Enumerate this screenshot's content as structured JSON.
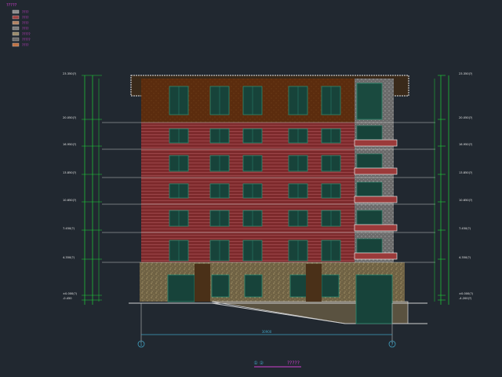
{
  "colors": {
    "background": "#212830",
    "brick": "#8a2f31",
    "roof_wood": "#5a2e10",
    "stone": "#8a7a52",
    "glass": "#17433a",
    "dim_green": "#1fd23a",
    "magenta": "#cf3fcf",
    "cyan": "#40a0c0",
    "white": "#e8e8e8"
  },
  "legend": {
    "title": "?????",
    "items": [
      {
        "label": "????",
        "swatch": "#8a8a8a"
      },
      {
        "label": "????",
        "swatch": "#a04040"
      },
      {
        "label": "????",
        "swatch": "#b08060"
      },
      {
        "label": "????",
        "swatch": "#7a7a7a"
      },
      {
        "label": "?????",
        "swatch": "#9a8a6a"
      },
      {
        "label": "?????",
        "swatch": "#6a6a6a"
      },
      {
        "label": "????",
        "swatch": "#c07040"
      }
    ]
  },
  "elevation_labels": {
    "left": [
      "23.350(?)",
      "20.050(?)",
      "16.950(?)",
      "13.850(?)",
      "10.650(?)",
      "7.450(?)",
      "4.350(?)",
      "±0.000(?)",
      "-0.450"
    ],
    "right": [
      "23.350(?)",
      "20.050(?)",
      "16.950(?)",
      "13.850(?)",
      "10.650(?)",
      "7.450(?)",
      "4.350(?)",
      "±0.000(?)",
      "-4.200(?)"
    ]
  },
  "axis_marks": {
    "left": "1",
    "right": "7"
  },
  "dimension_text": "30900",
  "drawing_title": {
    "marks": "① ②",
    "text": "?????"
  }
}
